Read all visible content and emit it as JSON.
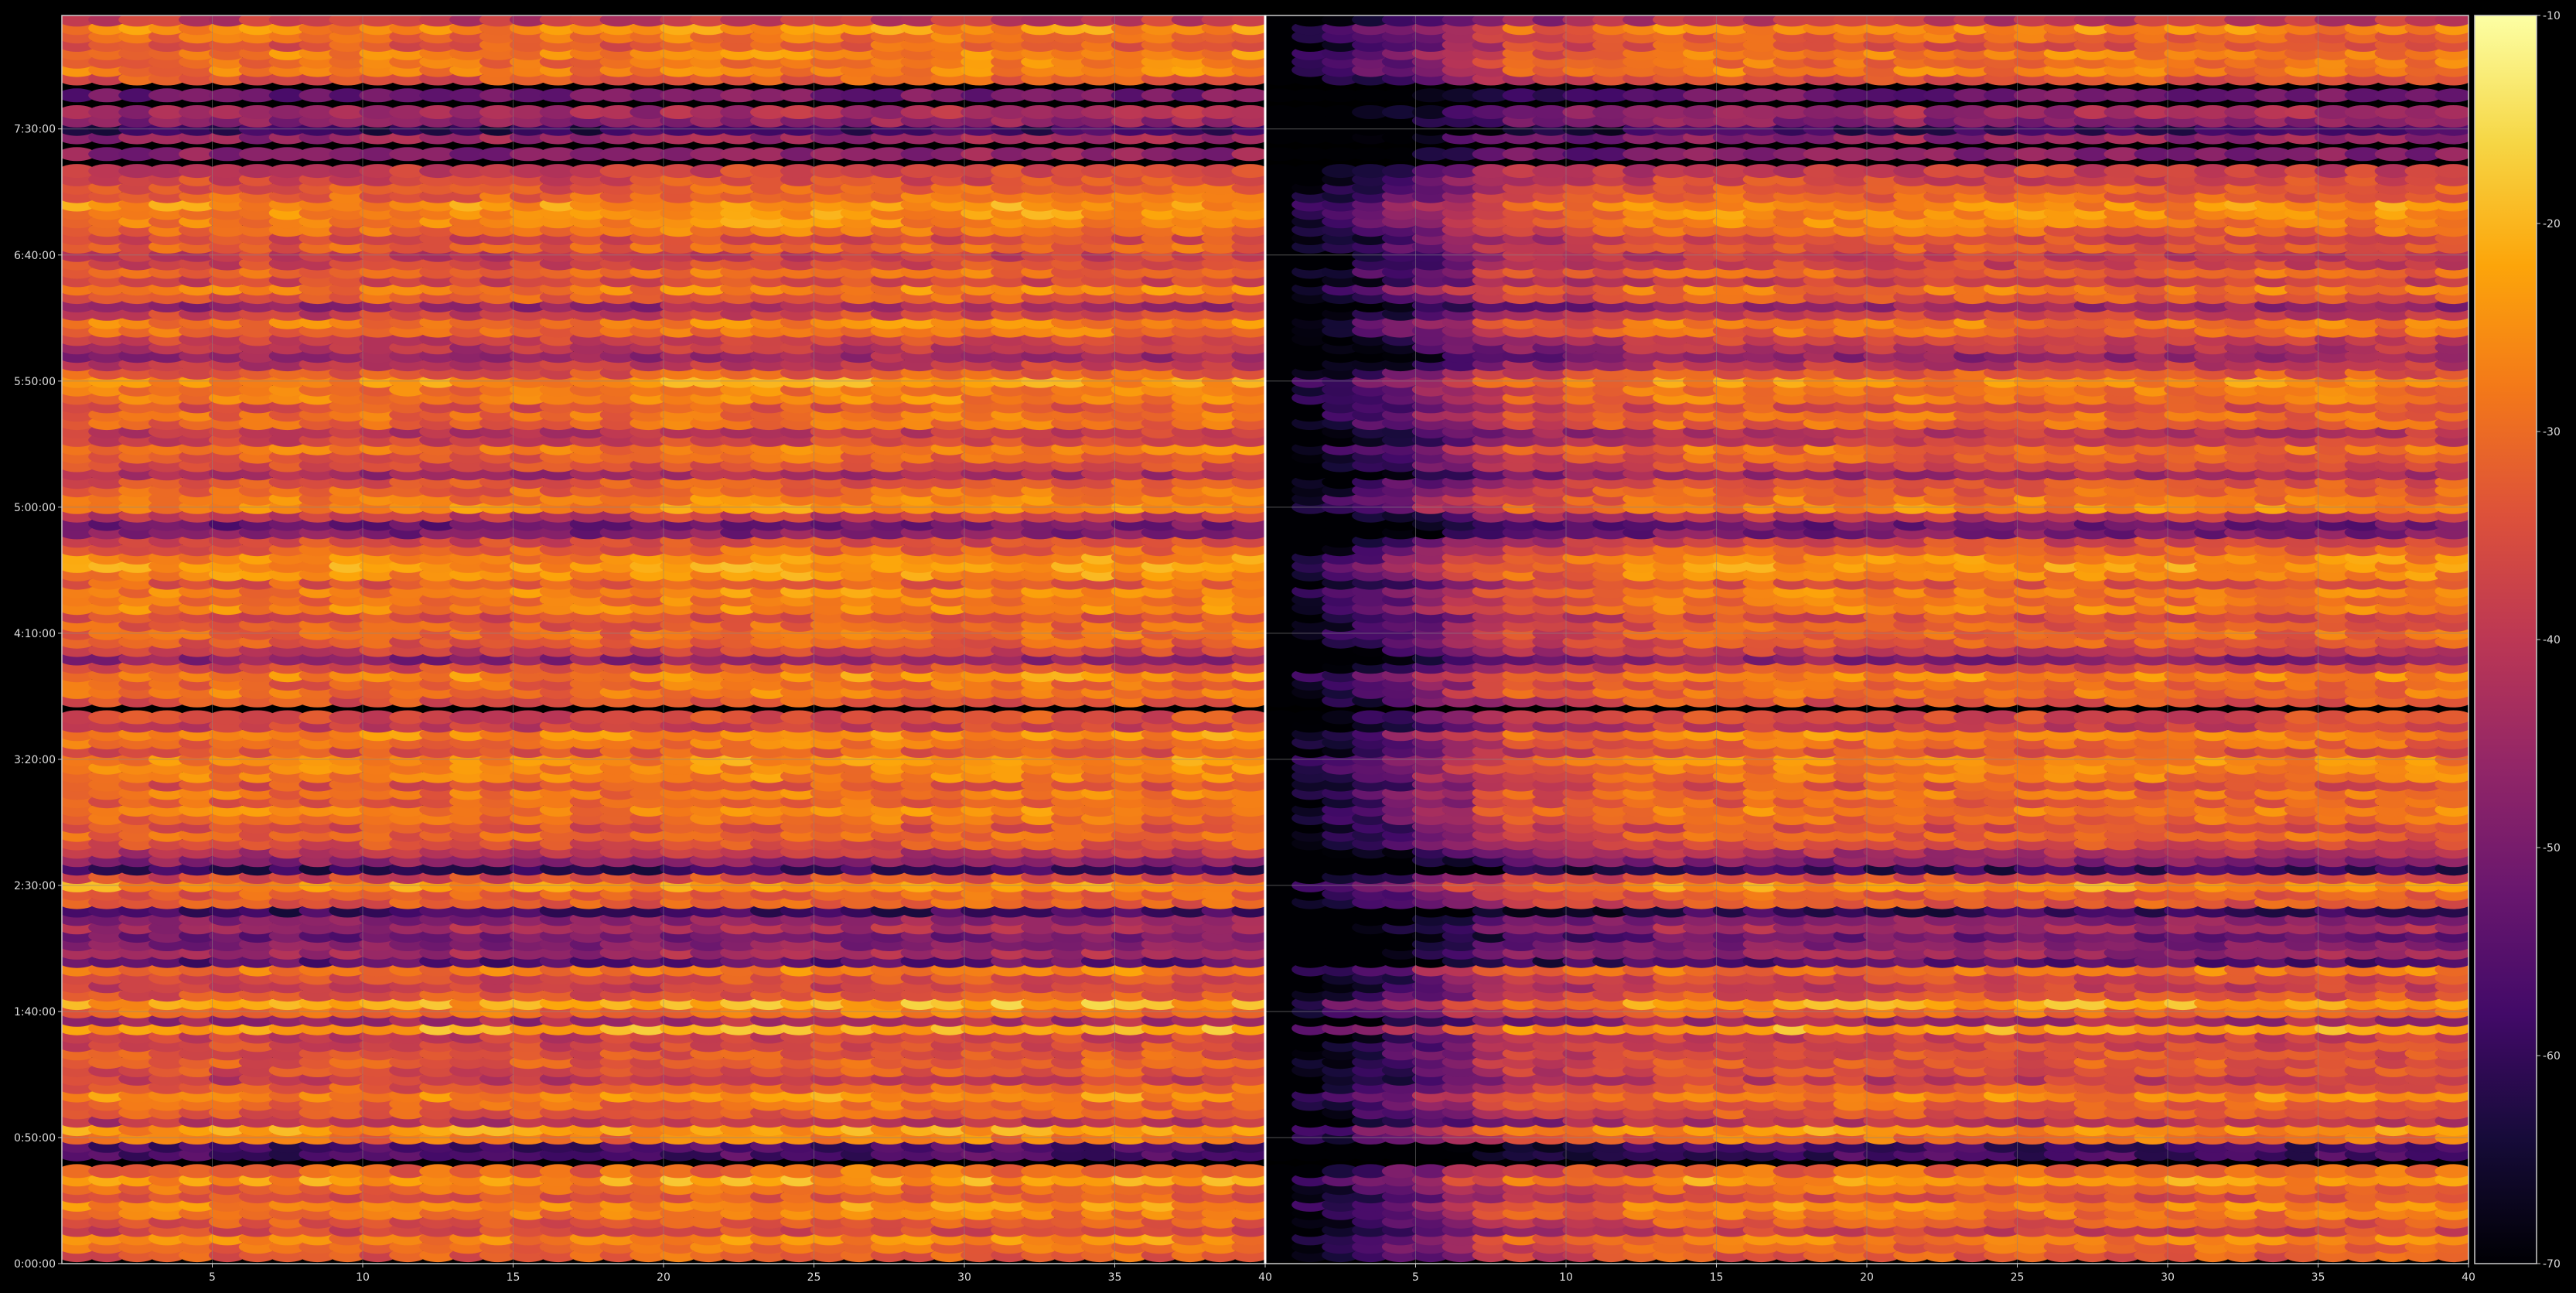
{
  "chart_data": {
    "type": "heatmap",
    "panels": [
      {
        "name": "",
        "x_range": [
          1,
          40
        ]
      },
      {
        "name": "",
        "x_range": [
          1,
          40
        ]
      }
    ],
    "xticks": [
      5,
      10,
      15,
      20,
      25,
      30,
      35,
      40
    ],
    "yticks": [
      "0:00:00",
      "0:50:00",
      "1:40:00",
      "2:30:00",
      "3:20:00",
      "4:10:00",
      "5:00:00",
      "5:50:00",
      "6:40:00",
      "7:30:00"
    ],
    "ylim_seconds": [
      0,
      29700
    ],
    "colorbar": {
      "ticks": [
        -10,
        -20,
        -30,
        -40,
        -50,
        -60,
        -70
      ],
      "range": [
        -70,
        -10
      ],
      "colormap": "inferno"
    },
    "grid": true,
    "colors": {
      "background": "#000000",
      "axis": "#cccccc",
      "grid": "#888888",
      "text": "#dddddd"
    },
    "bands": [
      {
        "t": 200,
        "v": -33
      },
      {
        "t": 400,
        "v": -31
      },
      {
        "t": 600,
        "v": -27
      },
      {
        "t": 800,
        "v": -37
      },
      {
        "t": 1000,
        "v": -33
      },
      {
        "t": 1200,
        "v": -29
      },
      {
        "t": 1400,
        "v": -26
      },
      {
        "t": 1600,
        "v": -34
      },
      {
        "t": 1800,
        "v": -31
      },
      {
        "t": 2000,
        "v": -24
      },
      {
        "t": 2200,
        "v": -31
      },
      {
        "t": 2600,
        "v": -58
      },
      {
        "t": 2800,
        "v": -58
      },
      {
        "t": 3000,
        "v": -29
      },
      {
        "t": 3200,
        "v": -24
      },
      {
        "t": 3400,
        "v": -41
      },
      {
        "t": 3600,
        "v": -33
      },
      {
        "t": 3800,
        "v": -31
      },
      {
        "t": 4000,
        "v": -26
      },
      {
        "t": 4200,
        "v": -33
      },
      {
        "t": 4400,
        "v": -39
      },
      {
        "t": 4600,
        "v": -35
      },
      {
        "t": 4800,
        "v": -33
      },
      {
        "t": 5000,
        "v": -34
      },
      {
        "t": 5200,
        "v": -36
      },
      {
        "t": 5400,
        "v": -38
      },
      {
        "t": 5600,
        "v": -22
      },
      {
        "t": 5800,
        "v": -44
      },
      {
        "t": 6000,
        "v": -30
      },
      {
        "t": 6200,
        "v": -22
      },
      {
        "t": 6400,
        "v": -34
      },
      {
        "t": 6600,
        "v": -38
      },
      {
        "t": 6800,
        "v": -36
      },
      {
        "t": 7000,
        "v": -28
      },
      {
        "t": 7200,
        "v": -55
      },
      {
        "t": 7400,
        "v": -45
      },
      {
        "t": 7600,
        "v": -49
      },
      {
        "t": 7800,
        "v": -52
      },
      {
        "t": 8000,
        "v": -44
      },
      {
        "t": 8200,
        "v": -48
      },
      {
        "t": 8400,
        "v": -60
      },
      {
        "t": 8600,
        "v": -33
      },
      {
        "t": 8800,
        "v": -32
      },
      {
        "t": 9000,
        "v": -24
      },
      {
        "t": 9200,
        "v": -36
      },
      {
        "t": 9400,
        "v": -60
      },
      {
        "t": 9600,
        "v": -48
      },
      {
        "t": 9800,
        "v": -42
      },
      {
        "t": 10000,
        "v": -35
      },
      {
        "t": 10200,
        "v": -31
      },
      {
        "t": 10400,
        "v": -35
      },
      {
        "t": 10600,
        "v": -30
      },
      {
        "t": 10800,
        "v": -27
      },
      {
        "t": 11000,
        "v": -32
      },
      {
        "t": 11200,
        "v": -29
      },
      {
        "t": 11400,
        "v": -34
      },
      {
        "t": 11600,
        "v": -28
      },
      {
        "t": 11800,
        "v": -27
      },
      {
        "t": 12000,
        "v": -26
      },
      {
        "t": 12200,
        "v": -34
      },
      {
        "t": 12400,
        "v": -30
      },
      {
        "t": 12600,
        "v": -26
      },
      {
        "t": 12800,
        "v": -38
      },
      {
        "t": 13000,
        "v": -36
      },
      {
        "t": 13400,
        "v": -34
      },
      {
        "t": 13600,
        "v": -29
      },
      {
        "t": 13800,
        "v": -31
      },
      {
        "t": 14000,
        "v": -26
      },
      {
        "t": 14200,
        "v": -36
      },
      {
        "t": 14400,
        "v": -48
      },
      {
        "t": 14600,
        "v": -38
      },
      {
        "t": 14800,
        "v": -33
      },
      {
        "t": 15000,
        "v": -30
      },
      {
        "t": 15200,
        "v": -32
      },
      {
        "t": 15400,
        "v": -35
      },
      {
        "t": 15600,
        "v": -27
      },
      {
        "t": 15800,
        "v": -29
      },
      {
        "t": 16000,
        "v": -27
      },
      {
        "t": 16200,
        "v": -33
      },
      {
        "t": 16400,
        "v": -26
      },
      {
        "t": 16600,
        "v": -24
      },
      {
        "t": 16800,
        "v": -26
      },
      {
        "t": 17000,
        "v": -32
      },
      {
        "t": 17200,
        "v": -36
      },
      {
        "t": 17400,
        "v": -50
      },
      {
        "t": 17600,
        "v": -52
      },
      {
        "t": 17800,
        "v": -40
      },
      {
        "t": 18000,
        "v": -26
      },
      {
        "t": 18200,
        "v": -28
      },
      {
        "t": 18400,
        "v": -31
      },
      {
        "t": 18600,
        "v": -34
      },
      {
        "t": 18800,
        "v": -44
      },
      {
        "t": 19000,
        "v": -36
      },
      {
        "t": 19200,
        "v": -32
      },
      {
        "t": 19400,
        "v": -29
      },
      {
        "t": 19600,
        "v": -38
      },
      {
        "t": 19800,
        "v": -40
      },
      {
        "t": 20000,
        "v": -31
      },
      {
        "t": 20200,
        "v": -30
      },
      {
        "t": 20400,
        "v": -34
      },
      {
        "t": 20600,
        "v": -28
      },
      {
        "t": 20800,
        "v": -29
      },
      {
        "t": 21000,
        "v": -25
      },
      {
        "t": 21200,
        "v": -33
      },
      {
        "t": 21400,
        "v": -40
      },
      {
        "t": 21600,
        "v": -46
      },
      {
        "t": 21800,
        "v": -41
      },
      {
        "t": 22000,
        "v": -38
      },
      {
        "t": 22200,
        "v": -30
      },
      {
        "t": 22400,
        "v": -28
      },
      {
        "t": 22600,
        "v": -38
      },
      {
        "t": 22800,
        "v": -46
      },
      {
        "t": 23000,
        "v": -33
      },
      {
        "t": 23200,
        "v": -28
      },
      {
        "t": 23400,
        "v": -37
      },
      {
        "t": 23600,
        "v": -31
      },
      {
        "t": 23800,
        "v": -37
      },
      {
        "t": 24000,
        "v": -39
      },
      {
        "t": 24200,
        "v": -32
      },
      {
        "t": 24400,
        "v": -36
      },
      {
        "t": 24600,
        "v": -30
      },
      {
        "t": 24800,
        "v": -27
      },
      {
        "t": 25000,
        "v": -26
      },
      {
        "t": 25200,
        "v": -25
      },
      {
        "t": 25400,
        "v": -31
      },
      {
        "t": 25600,
        "v": -33
      },
      {
        "t": 25800,
        "v": -36
      },
      {
        "t": 26000,
        "v": -38
      },
      {
        "t": 26400,
        "v": -48
      },
      {
        "t": 26800,
        "v": -46
      },
      {
        "t": 27000,
        "v": -60
      },
      {
        "t": 27200,
        "v": -48
      },
      {
        "t": 27400,
        "v": -44
      },
      {
        "t": 27800,
        "v": -52
      },
      {
        "t": 28200,
        "v": -34
      },
      {
        "t": 28400,
        "v": -28
      },
      {
        "t": 28600,
        "v": -29
      },
      {
        "t": 28800,
        "v": -27
      },
      {
        "t": 29000,
        "v": -33
      },
      {
        "t": 29200,
        "v": -30
      },
      {
        "t": 29400,
        "v": -26
      },
      {
        "t": 29600,
        "v": -40
      }
    ]
  }
}
